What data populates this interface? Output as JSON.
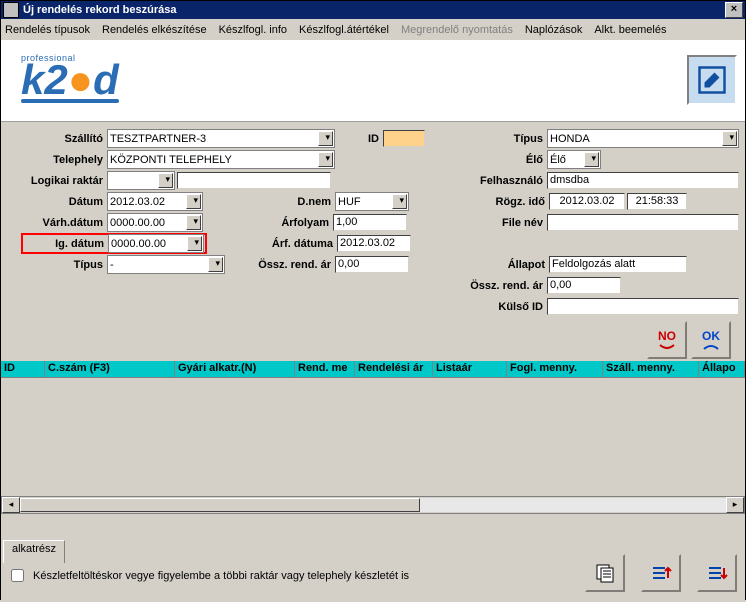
{
  "window": {
    "title": "Új rendelés rekord beszúrása"
  },
  "menu": {
    "m1": "Rendelés típusok",
    "m2": "Rendelés elkészítése",
    "m3": "Készlfogl. info",
    "m4": "Készlfogl.átértékel",
    "m5": "Megrendelő nyomtatás",
    "m6": "Naplózások",
    "m7": "Alkt. beemelés"
  },
  "labels": {
    "szallito": "Szállító",
    "id": "ID",
    "tipus": "Típus",
    "telephely": "Telephely",
    "elo": "Élő",
    "logikai": "Logikai raktár",
    "felhasznalo": "Felhasználó",
    "datum": "Dátum",
    "dnem": "D.nem",
    "rogzido": "Rögz. idő",
    "varh": "Várh.dátum",
    "arfolyam": "Árfolyam",
    "filenev": "File név",
    "igdatum": "Ig. dátum",
    "arfdatuma": "Árf. dátuma",
    "tipus2": "Típus",
    "osszrend": "Össz. rend. ár",
    "allapot": "Állapot",
    "osszrend2": "Össz. rend. ár",
    "kulsoid": "Külső ID"
  },
  "values": {
    "szallito": "TESZTPARTNER-3",
    "id": "",
    "tipus": "HONDA",
    "telephely": "KÖZPONTI TELEPHELY",
    "elo": "Élő",
    "logikai1": "",
    "logikai2": "",
    "felhasznalo": "dmsdba",
    "datum": "2012.03.02",
    "dnem": "HUF",
    "rogzido1": "2012.03.02",
    "rogzido2": "21:58:33",
    "varh": "0000.00.00",
    "arfolyam": "1,00",
    "filenev": "",
    "igdatum": "0000.00.00",
    "arfdatuma": "2012.03.02",
    "tipus2": "-",
    "osszrend": "0,00",
    "allapot": "Feldolgozás alatt",
    "osszrend2": "0,00",
    "kulsoid": ""
  },
  "grid": {
    "h1": "ID",
    "h2": "C.szám (F3)",
    "h3": "Gyári alkatr.(N)",
    "h4": "Rend. me",
    "h5": "Rendelési ár",
    "h6": "Listaár",
    "h7": "Fogl. menny.",
    "h8": "Száll. menny.",
    "h9": "Állapo"
  },
  "footer": {
    "tab": "alkatrész",
    "chk": "Készletfeltöltéskor vegye figyelembe a többi raktár vagy telephely készletét is"
  },
  "buttons": {
    "no": "NO",
    "ok": "OK"
  }
}
